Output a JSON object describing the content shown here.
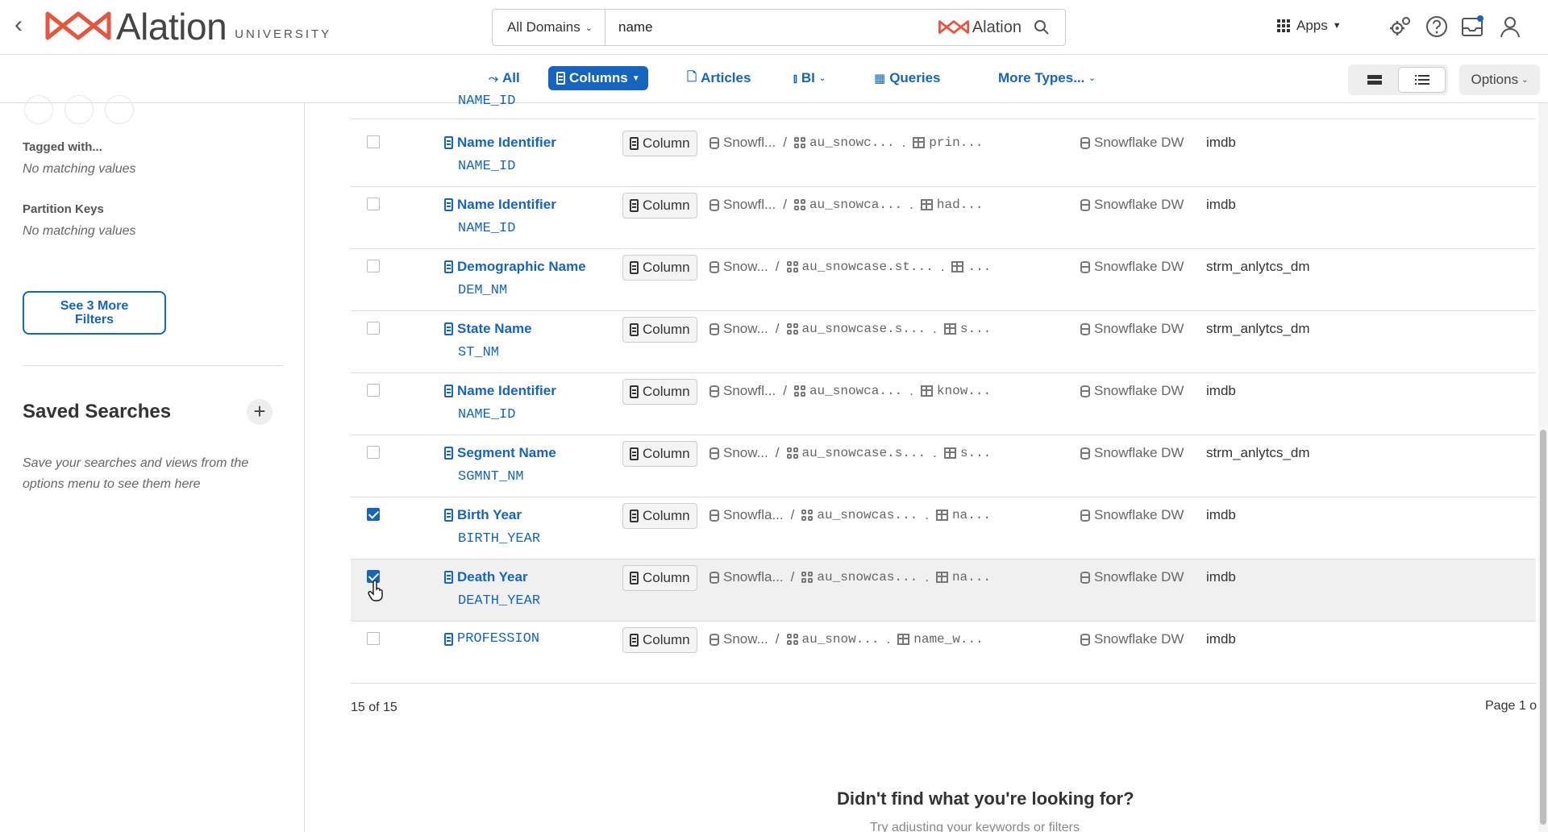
{
  "header": {
    "brand": "Alation",
    "brand_suffix": "UNIVERSITY",
    "domain_selector": "All Domains",
    "search_value": "name",
    "search_brand": "Alation",
    "apps_label": "Apps",
    "accent_color": "#e8553e"
  },
  "typebar": {
    "tabs": [
      {
        "label": "All",
        "icon": "trend-icon",
        "active": false
      },
      {
        "label": "Columns",
        "icon": "column-icon",
        "active": true
      },
      {
        "label": "Articles",
        "icon": "article-icon",
        "active": false
      },
      {
        "label": "BI",
        "icon": "bar-chart-icon",
        "active": false
      },
      {
        "label": "Queries",
        "icon": "query-icon",
        "active": false
      },
      {
        "label": "More Types...",
        "icon": "",
        "active": false
      }
    ],
    "options_label": "Options",
    "active_color": "#1565c0"
  },
  "sidebar": {
    "tagged_label": "Tagged with...",
    "tagged_empty": "No matching values",
    "partition_label": "Partition Keys",
    "partition_empty": "No matching values",
    "more_filters": "See 3 More Filters",
    "saved_title": "Saved Searches",
    "saved_note": "Save your searches and views from the options menu to see them here"
  },
  "results": {
    "partial_row_tech": "NAME_ID",
    "badge_label": "Column",
    "rows": [
      {
        "title": "Name Identifier",
        "tech": "NAME_ID",
        "db": "Snowfl...",
        "schema_path": "au_snowc...",
        "table": "prin...",
        "source": "Snowflake DW",
        "schema": "imdb",
        "checked": false
      },
      {
        "title": "Name Identifier",
        "tech": "NAME_ID",
        "db": "Snowfl...",
        "schema_path": "au_snowca...",
        "table": "had...",
        "source": "Snowflake DW",
        "schema": "imdb",
        "checked": false
      },
      {
        "title": "Demographic Name",
        "tech": "DEM_NM",
        "db": "Snow...",
        "schema_path": "au_snowcase.st...",
        "table": "...",
        "source": "Snowflake DW",
        "schema": "strm_anlytcs_dm",
        "checked": false
      },
      {
        "title": "State Name",
        "tech": "ST_NM",
        "db": "Snow...",
        "schema_path": "au_snowcase.s...",
        "table": "s...",
        "source": "Snowflake DW",
        "schema": "strm_anlytcs_dm",
        "checked": false
      },
      {
        "title": "Name Identifier",
        "tech": "NAME_ID",
        "db": "Snowfl...",
        "schema_path": "au_snowca...",
        "table": "know...",
        "source": "Snowflake DW",
        "schema": "imdb",
        "checked": false
      },
      {
        "title": "Segment Name",
        "tech": "SGMNT_NM",
        "db": "Snow...",
        "schema_path": "au_snowcase.s...",
        "table": "s...",
        "source": "Snowflake DW",
        "schema": "strm_anlytcs_dm",
        "checked": false
      },
      {
        "title": "Birth Year",
        "tech": "BIRTH_YEAR",
        "db": "Snowfla...",
        "schema_path": "au_snowcas...",
        "table": "na...",
        "source": "Snowflake DW",
        "schema": "imdb",
        "checked": true
      },
      {
        "title": "Death Year",
        "tech": "DEATH_YEAR",
        "db": "Snowfla...",
        "schema_path": "au_snowcas...",
        "table": "na...",
        "source": "Snowflake DW",
        "schema": "imdb",
        "checked": true
      },
      {
        "title": "PROFESSION",
        "tech": "",
        "db": "Snow...",
        "schema_path": "au_snow...",
        "table": "name_w...",
        "source": "Snowflake DW",
        "schema": "imdb",
        "checked": false
      }
    ],
    "count": "15 of 15",
    "page_info": "Page 1 o",
    "not_found": "Didn't find what you're looking for?",
    "hint": "Try adjusting your keywords or filters"
  }
}
